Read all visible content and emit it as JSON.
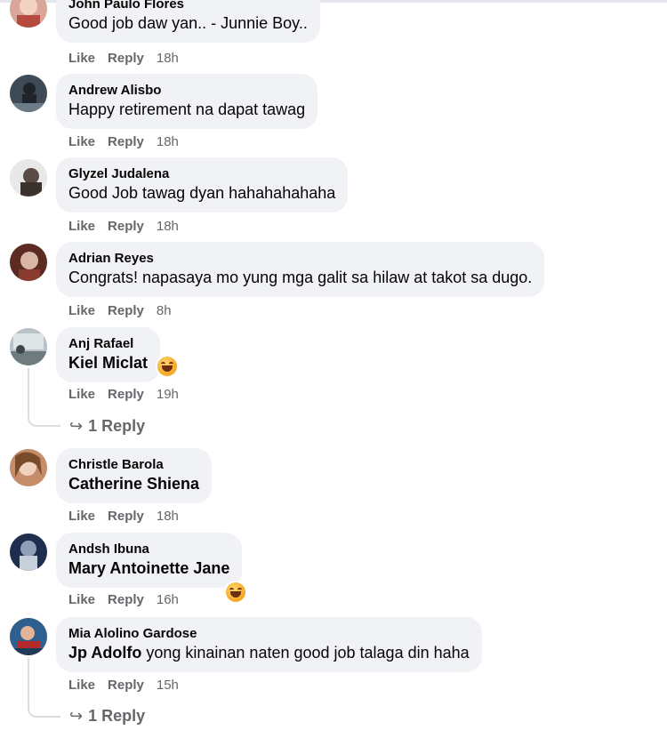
{
  "actions": {
    "like": "Like",
    "reply": "Reply"
  },
  "comments": [
    {
      "author": "John Paulo Flores",
      "tag": "",
      "text": "Good job daw yan.. - Junnie Boy..",
      "time": "18h"
    },
    {
      "author": "Andrew Alisbo",
      "tag": "",
      "text": "Happy retirement na dapat tawag",
      "time": "18h"
    },
    {
      "author": "Glyzel Judalena",
      "tag": "",
      "text": "Good Job tawag dyan hahahahahaha",
      "time": "18h"
    },
    {
      "author": "Adrian Reyes",
      "tag": "",
      "text": "Congrats! napasaya mo yung mga galit sa hilaw at takot sa dugo.",
      "time": "8h"
    },
    {
      "author": "Anj Rafael",
      "tag": "Kiel Miclat",
      "text": "",
      "time": "19h",
      "replies": "1 Reply",
      "reaction_icon": "laughing-emoji"
    },
    {
      "author": "Christle Barola",
      "tag": "Catherine Shiena",
      "text": "",
      "time": "18h"
    },
    {
      "author": "Andsh Ibuna",
      "tag": "Mary Antoinette Jane",
      "text": "",
      "time": "16h",
      "reaction_icon": "laughing-emoji"
    },
    {
      "author": "Mia Alolino Gardose",
      "tag": "Jp Adolfo",
      "text": "yong kinainan naten good job talaga din haha",
      "time": "15h",
      "replies": "1 Reply"
    }
  ],
  "colors": {
    "bubble": "#f0f2f5",
    "meta": "#65676b",
    "text": "#050505"
  },
  "icons": {
    "reply_arrow": "↪"
  }
}
